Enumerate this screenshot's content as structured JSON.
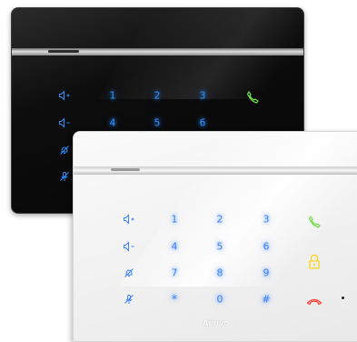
{
  "colors": {
    "key_blue": "#2d8fff",
    "call_green": "#6ee04a",
    "hangup_red": "#ff3b2f",
    "unlock_yellow": "#ffd21a"
  },
  "black_panel": {
    "keys": [
      "1",
      "2",
      "3",
      "4",
      "5",
      "6"
    ],
    "icons": [
      "volume-up-icon",
      "volume-down-icon",
      "bell-mute-icon",
      "mic-mute-icon",
      "call-answer-icon"
    ]
  },
  "white_panel": {
    "keys": [
      "1",
      "2",
      "3",
      "4",
      "5",
      "6",
      "7",
      "8",
      "9",
      "*",
      "0",
      "#"
    ],
    "icons": [
      "volume-up-icon",
      "volume-down-icon",
      "bell-mute-icon",
      "mic-mute-icon",
      "call-answer-icon",
      "unlock-icon",
      "hang-up-icon"
    ],
    "brand": "Aiiuvo"
  }
}
